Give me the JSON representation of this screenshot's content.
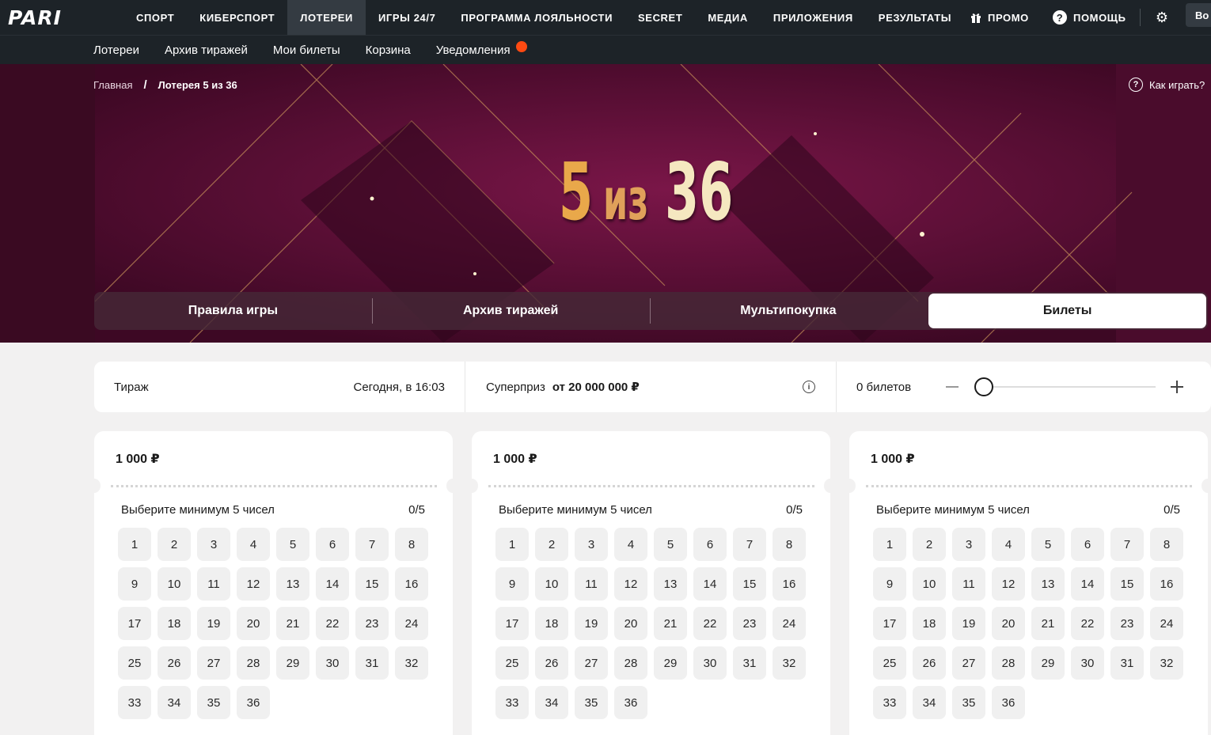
{
  "brand": {
    "logo_text": "PARI"
  },
  "topnav": {
    "items": [
      "СПОРТ",
      "КИБЕРСПОРТ",
      "ЛОТЕРЕИ",
      "ИГРЫ 24/7",
      "ПРОГРАММА ЛОЯЛЬНОСТИ",
      "SECRET",
      "МЕДИА",
      "ПРИЛОЖЕНИЯ",
      "РЕЗУЛЬТАТЫ"
    ],
    "active": "ЛОТЕРЕИ",
    "promo_label": "ПРОМО",
    "help_label": "ПОМОЩЬ",
    "login_label": "Во"
  },
  "subnav": {
    "items": [
      "Лотереи",
      "Архив тиражей",
      "Мои билеты",
      "Корзина",
      "Уведомления"
    ]
  },
  "breadcrumb": {
    "home": "Главная",
    "separator": "/",
    "current": "Лотерея 5 из 36"
  },
  "how_to_play": "Как играть?",
  "banner_title": {
    "left": "5",
    "middle": "из",
    "right": "36"
  },
  "tabs": {
    "items": [
      "Правила игры",
      "Архив тиражей",
      "Мультипокупка",
      "Билеты"
    ],
    "active": "Билеты"
  },
  "draw": {
    "label": "Тираж",
    "time": "Сегодня, в 16:03",
    "superprize_label": "Суперприз",
    "superprize_amount": "от 20 000 000 ₽",
    "tickets_count": "0 билетов",
    "tickets_slider_value": 0
  },
  "tickets": [
    {
      "price": "1 000 ₽",
      "hint": "Выберите минимум 5 чисел",
      "count": "0/5"
    },
    {
      "price": "1 000 ₽",
      "hint": "Выберите минимум 5 чисел",
      "count": "0/5"
    },
    {
      "price": "1 000 ₽",
      "hint": "Выберите минимум 5 чисел",
      "count": "0/5"
    }
  ],
  "numbers": [
    "1",
    "2",
    "3",
    "4",
    "5",
    "6",
    "7",
    "8",
    "9",
    "10",
    "11",
    "12",
    "13",
    "14",
    "15",
    "16",
    "17",
    "18",
    "19",
    "20",
    "21",
    "22",
    "23",
    "24",
    "25",
    "26",
    "27",
    "28",
    "29",
    "30",
    "31",
    "32",
    "33",
    "34",
    "35",
    "36"
  ],
  "colors": {
    "header_bg": "#1d2328",
    "banner_bg": "#5a0e38",
    "notification_dot": "#ff4a12",
    "gold": "#e9a84a"
  }
}
